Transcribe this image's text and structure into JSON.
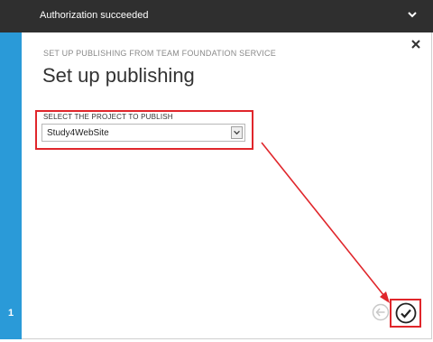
{
  "notification": {
    "title": "Authorization succeeded",
    "chevron_icon": "chevron-down-icon"
  },
  "wizard": {
    "step_number": "1",
    "subtitle": "SET UP PUBLISHING FROM TEAM FOUNDATION SERVICE",
    "title": "Set up publishing",
    "close_icon": "close-icon"
  },
  "project_field": {
    "label": "SELECT THE PROJECT TO PUBLISH",
    "selected_value": "Study4WebSite"
  },
  "footer": {
    "back_icon": "back-arrow-icon",
    "ok_icon": "checkmark-icon"
  },
  "colors": {
    "topbar": "#2f2f2f",
    "rail": "#2a9ad8",
    "highlight": "#e0262b"
  }
}
